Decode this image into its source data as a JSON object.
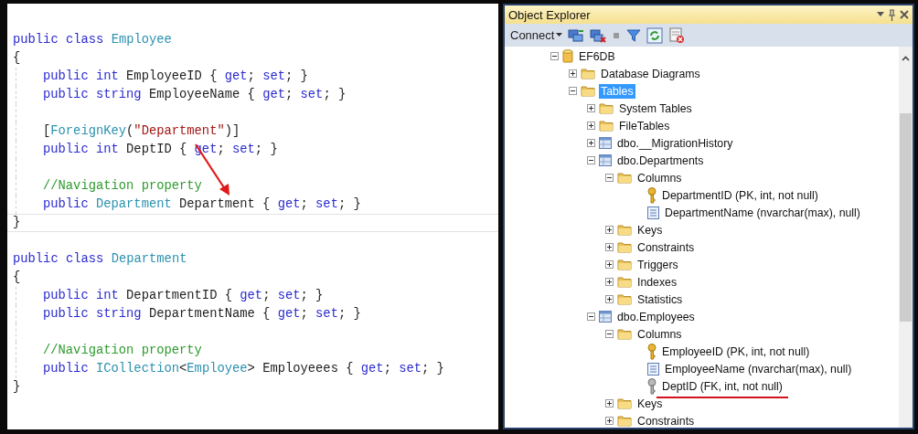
{
  "editor": {
    "lines": [
      {
        "kind": "code",
        "indented": false,
        "current": false,
        "tokens": [
          {
            "kind": "kw",
            "text": "public class "
          },
          {
            "kind": "type",
            "text": "Employee"
          }
        ]
      },
      {
        "kind": "code",
        "indented": false,
        "current": false,
        "tokens": [
          {
            "kind": "plain",
            "text": "{"
          }
        ]
      },
      {
        "kind": "code",
        "indented": true,
        "current": false,
        "tokens": [
          {
            "kind": "kw",
            "text": "public int "
          },
          {
            "kind": "plain",
            "text": "EmployeeID { "
          },
          {
            "kind": "kw",
            "text": "get"
          },
          {
            "kind": "plain",
            "text": "; "
          },
          {
            "kind": "kw",
            "text": "set"
          },
          {
            "kind": "plain",
            "text": "; }"
          }
        ]
      },
      {
        "kind": "code",
        "indented": true,
        "current": false,
        "tokens": [
          {
            "kind": "kw",
            "text": "public string "
          },
          {
            "kind": "plain",
            "text": "EmployeeName { "
          },
          {
            "kind": "kw",
            "text": "get"
          },
          {
            "kind": "plain",
            "text": "; "
          },
          {
            "kind": "kw",
            "text": "set"
          },
          {
            "kind": "plain",
            "text": "; }"
          }
        ]
      },
      {
        "kind": "blank",
        "indented": true,
        "current": false
      },
      {
        "kind": "code",
        "indented": true,
        "current": false,
        "tokens": [
          {
            "kind": "plain",
            "text": "["
          },
          {
            "kind": "type",
            "text": "ForeignKey"
          },
          {
            "kind": "plain",
            "text": "("
          },
          {
            "kind": "str",
            "text": "\"Department\""
          },
          {
            "kind": "plain",
            "text": ")]"
          }
        ]
      },
      {
        "kind": "code",
        "indented": true,
        "current": false,
        "tokens": [
          {
            "kind": "kw",
            "text": "public int "
          },
          {
            "kind": "plain",
            "text": "DeptID { "
          },
          {
            "kind": "kw",
            "text": "get"
          },
          {
            "kind": "plain",
            "text": "; "
          },
          {
            "kind": "kw",
            "text": "set"
          },
          {
            "kind": "plain",
            "text": "; }"
          }
        ]
      },
      {
        "kind": "blank",
        "indented": true,
        "current": false
      },
      {
        "kind": "code",
        "indented": true,
        "current": false,
        "tokens": [
          {
            "kind": "comment",
            "text": "//Navigation property"
          }
        ]
      },
      {
        "kind": "code",
        "indented": true,
        "current": false,
        "tokens": [
          {
            "kind": "kw",
            "text": "public "
          },
          {
            "kind": "type",
            "text": "Department"
          },
          {
            "kind": "plain",
            "text": " Department { "
          },
          {
            "kind": "kw",
            "text": "get"
          },
          {
            "kind": "plain",
            "text": "; "
          },
          {
            "kind": "kw",
            "text": "set"
          },
          {
            "kind": "plain",
            "text": "; }"
          }
        ]
      },
      {
        "kind": "code",
        "indented": false,
        "current": true,
        "tokens": [
          {
            "kind": "plain",
            "text": "}"
          }
        ]
      },
      {
        "kind": "blank",
        "indented": false,
        "current": false
      },
      {
        "kind": "code",
        "indented": false,
        "current": false,
        "tokens": [
          {
            "kind": "kw",
            "text": "public class "
          },
          {
            "kind": "type",
            "text": "Department"
          }
        ]
      },
      {
        "kind": "code",
        "indented": false,
        "current": false,
        "tokens": [
          {
            "kind": "plain",
            "text": "{"
          }
        ]
      },
      {
        "kind": "code",
        "indented": true,
        "current": false,
        "tokens": [
          {
            "kind": "kw",
            "text": "public int "
          },
          {
            "kind": "plain",
            "text": "DepartmentID { "
          },
          {
            "kind": "kw",
            "text": "get"
          },
          {
            "kind": "plain",
            "text": "; "
          },
          {
            "kind": "kw",
            "text": "set"
          },
          {
            "kind": "plain",
            "text": "; }"
          }
        ]
      },
      {
        "kind": "code",
        "indented": true,
        "current": false,
        "tokens": [
          {
            "kind": "kw",
            "text": "public string "
          },
          {
            "kind": "plain",
            "text": "DepartmentName { "
          },
          {
            "kind": "kw",
            "text": "get"
          },
          {
            "kind": "plain",
            "text": "; "
          },
          {
            "kind": "kw",
            "text": "set"
          },
          {
            "kind": "plain",
            "text": "; }"
          }
        ]
      },
      {
        "kind": "blank",
        "indented": true,
        "current": false
      },
      {
        "kind": "code",
        "indented": true,
        "current": false,
        "tokens": [
          {
            "kind": "comment",
            "text": "//Navigation property"
          }
        ]
      },
      {
        "kind": "code",
        "indented": true,
        "current": false,
        "tokens": [
          {
            "kind": "kw",
            "text": "public "
          },
          {
            "kind": "type",
            "text": "ICollection"
          },
          {
            "kind": "plain",
            "text": "<"
          },
          {
            "kind": "type",
            "text": "Employee"
          },
          {
            "kind": "plain",
            "text": "> Employeees { "
          },
          {
            "kind": "kw",
            "text": "get"
          },
          {
            "kind": "plain",
            "text": "; "
          },
          {
            "kind": "kw",
            "text": "set"
          },
          {
            "kind": "plain",
            "text": "; }"
          }
        ]
      },
      {
        "kind": "code",
        "indented": false,
        "current": false,
        "tokens": [
          {
            "kind": "plain",
            "text": "}"
          }
        ]
      }
    ]
  },
  "object_explorer": {
    "title": "Object Explorer",
    "toolbar": {
      "connect": "Connect"
    },
    "tree": [
      {
        "label": "EF6DB",
        "kind": "database",
        "expanded": true,
        "selected": false,
        "children": [
          {
            "label": "Database Diagrams",
            "kind": "folder",
            "expanded": false,
            "selected": false
          },
          {
            "label": "Tables",
            "kind": "folder",
            "expanded": true,
            "selected": true,
            "children": [
              {
                "label": "System Tables",
                "kind": "folder",
                "expanded": false,
                "selected": false
              },
              {
                "label": "FileTables",
                "kind": "folder",
                "expanded": false,
                "selected": false
              },
              {
                "label": "dbo.__MigrationHistory",
                "kind": "table",
                "expanded": false,
                "selected": false
              },
              {
                "label": "dbo.Departments",
                "kind": "table",
                "expanded": true,
                "selected": false,
                "children": [
                  {
                    "label": "Columns",
                    "kind": "folder",
                    "expanded": true,
                    "selected": false,
                    "children": [
                      {
                        "label": "DepartmentID (PK, int, not null)",
                        "kind": "primary-key",
                        "selected": false
                      },
                      {
                        "label": "DepartmentName (nvarchar(max), null)",
                        "kind": "column",
                        "selected": false
                      }
                    ]
                  },
                  {
                    "label": "Keys",
                    "kind": "folder",
                    "expanded": false,
                    "selected": false
                  },
                  {
                    "label": "Constraints",
                    "kind": "folder",
                    "expanded": false,
                    "selected": false
                  },
                  {
                    "label": "Triggers",
                    "kind": "folder",
                    "expanded": false,
                    "selected": false
                  },
                  {
                    "label": "Indexes",
                    "kind": "folder",
                    "expanded": false,
                    "selected": false
                  },
                  {
                    "label": "Statistics",
                    "kind": "folder",
                    "expanded": false,
                    "selected": false
                  }
                ]
              },
              {
                "label": "dbo.Employees",
                "kind": "table",
                "expanded": true,
                "selected": false,
                "children": [
                  {
                    "label": "Columns",
                    "kind": "folder",
                    "expanded": true,
                    "selected": false,
                    "children": [
                      {
                        "label": "EmployeeID (PK, int, not null)",
                        "kind": "primary-key",
                        "selected": false
                      },
                      {
                        "label": "EmployeeName (nvarchar(max), null)",
                        "kind": "column",
                        "selected": false
                      },
                      {
                        "label": "DeptID (FK, int, not null)",
                        "kind": "foreign-key",
                        "selected": false,
                        "underlined": true
                      }
                    ]
                  },
                  {
                    "label": "Keys",
                    "kind": "folder",
                    "expanded": false,
                    "selected": false
                  },
                  {
                    "label": "Constraints",
                    "kind": "folder",
                    "expanded": false,
                    "selected": false
                  }
                ]
              }
            ]
          }
        ]
      }
    ]
  }
}
